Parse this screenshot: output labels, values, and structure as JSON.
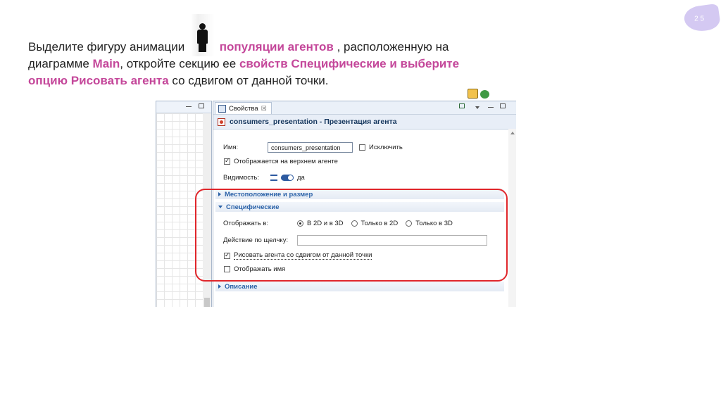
{
  "slide": {
    "number": "2 5",
    "instruction": {
      "p1": "Выделите фигуру анимации ",
      "p2": "популяции агентов",
      "p3": " , расположенную на диаграмме ",
      "p4": "Main",
      "p5": ", откройте секцию ее ",
      "p6": "свойств Специфические и выберите опцию Рисовать агента",
      "p7": " со сдвигом от данной точки."
    }
  },
  "properties_panel": {
    "tab_label": "Свойства",
    "tab_close": "☒",
    "title": "consumers_presentation - Презентация агента",
    "name_label": "Имя:",
    "name_value": "consumers_presentation",
    "exclude_label": "Исключить",
    "show_on_top_label": "Отображается на верхнем агенте",
    "visibility_label": "Видимость:",
    "visibility_value": "да",
    "sections": {
      "location": "Местоположение и размер",
      "specific": "Специфические",
      "description": "Описание"
    },
    "specific": {
      "display_in_label": "Отображать в:",
      "options": [
        "В 2D и в 3D",
        "Только в 2D",
        "Только в 3D"
      ],
      "selected_option": "В 2D и в 3D",
      "on_click_label": "Действие по щелчку:",
      "on_click_value": "",
      "draw_agent_label": "Рисовать агента со сдвигом от данной точки",
      "draw_agent_checked": true,
      "show_name_label": "Отображать имя",
      "show_name_checked": false
    },
    "show_on_top_checked": true,
    "exclude_checked": false
  },
  "colors": {
    "highlight": "#c4479a",
    "annotation_red": "#e0262b",
    "section_blue": "#2b62a8"
  }
}
